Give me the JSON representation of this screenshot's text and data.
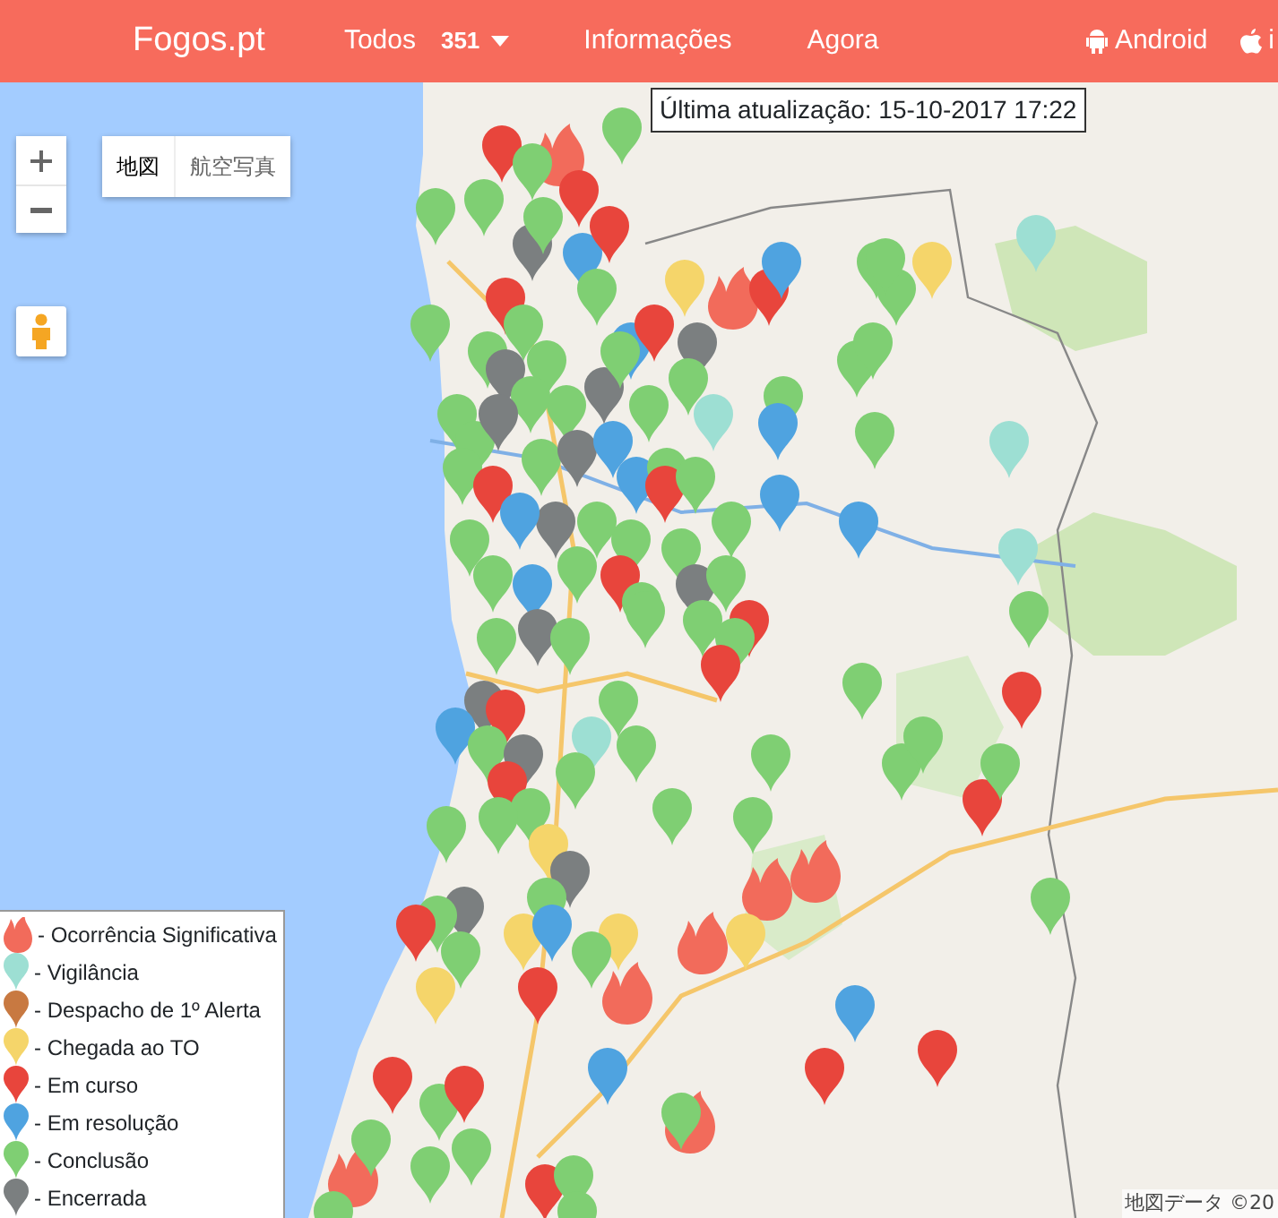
{
  "navbar": {
    "brand": "Fogos.pt",
    "items": [
      {
        "label": "Todos",
        "count": "351",
        "kind": "dropdown"
      },
      {
        "label": "Informações",
        "kind": "link"
      },
      {
        "label": "Agora",
        "kind": "link"
      }
    ],
    "right_items": [
      {
        "label": "Android",
        "kind": "android"
      },
      {
        "label": "i",
        "kind": "apple"
      }
    ]
  },
  "map": {
    "map_type_buttons": [
      {
        "label": "地図",
        "selected": true
      },
      {
        "label": "航空写真",
        "selected": false
      }
    ],
    "last_update": "Última atualização: 15-10-2017 17:22",
    "attribution": "地図データ ©20",
    "legend": [
      {
        "label": "- Ocorrência Significativa",
        "kind": "fire",
        "color": "#f26b5b"
      },
      {
        "label": "- Vigilância",
        "kind": "pin",
        "color": "#9ddfd3"
      },
      {
        "label": "- Despacho de 1º Alerta",
        "kind": "pin",
        "color": "#c87941"
      },
      {
        "label": "- Chegada ao TO",
        "kind": "pin",
        "color": "#f5d56a"
      },
      {
        "label": "- Em curso",
        "kind": "pin",
        "color": "#e8453c"
      },
      {
        "label": "- Em resolução",
        "kind": "pin",
        "color": "#4fa3e0"
      },
      {
        "label": "- Conclusão",
        "kind": "pin",
        "color": "#7fcf73"
      },
      {
        "label": "- Encerrada",
        "kind": "pin",
        "color": "#7b7f80"
      }
    ]
  }
}
